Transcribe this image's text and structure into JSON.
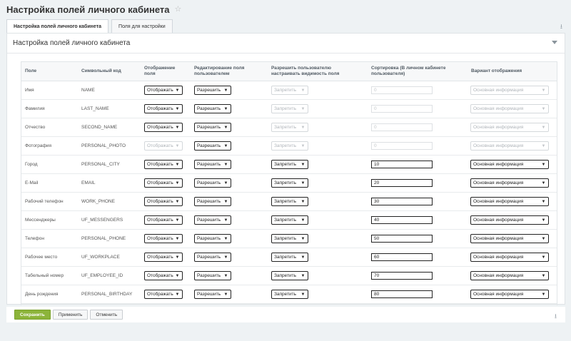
{
  "page": {
    "title": "Настройка полей личного кабинета"
  },
  "tabs": [
    {
      "label": "Настройка полей личного кабинета",
      "active": true
    },
    {
      "label": "Поля для настройки",
      "active": false
    }
  ],
  "panel": {
    "title": "Настройка полей личного кабинета"
  },
  "table": {
    "headers": {
      "field": "Поле",
      "code": "Символьный код",
      "display": [
        "Отображение",
        "поля"
      ],
      "edit": [
        "Редактирование поля",
        "пользователем"
      ],
      "visibility": [
        "Разрешить пользователю",
        "настраивать видимость поля"
      ],
      "sort": [
        "Сортировка (В личном кабинете",
        "пользователя)"
      ],
      "variant": "Вариант отображения"
    },
    "rows": [
      {
        "field": "Имя",
        "code": "NAME",
        "display": "Отображать",
        "edit": "Разрешить",
        "visibility": "Запретить",
        "sort": "0",
        "variant": "Основная информация",
        "display_disabled": false,
        "edit_disabled": false,
        "rest_disabled": true
      },
      {
        "field": "Фамилия",
        "code": "LAST_NAME",
        "display": "Отображать",
        "edit": "Разрешить",
        "visibility": "Запретить",
        "sort": "0",
        "variant": "Основная информация",
        "display_disabled": false,
        "edit_disabled": false,
        "rest_disabled": true
      },
      {
        "field": "Отчество",
        "code": "SECOND_NAME",
        "display": "Отображать",
        "edit": "Разрешить",
        "visibility": "Запретить",
        "sort": "0",
        "variant": "Основная информация",
        "display_disabled": false,
        "edit_disabled": false,
        "rest_disabled": true
      },
      {
        "field": "Фотография",
        "code": "PERSONAL_PHOTO",
        "display": "Отображать",
        "edit": "Разрешить",
        "visibility": "Запретить",
        "sort": "0",
        "variant": "Основная информация",
        "display_disabled": true,
        "edit_disabled": false,
        "rest_disabled": true
      },
      {
        "field": "Город",
        "code": "PERSONAL_CITY",
        "display": "Отображать",
        "edit": "Разрешить",
        "visibility": "Запретить",
        "sort": "10",
        "variant": "Основная информация",
        "display_disabled": false,
        "edit_disabled": false,
        "rest_disabled": false
      },
      {
        "field": "E-Mail",
        "code": "EMAIL",
        "display": "Отображать",
        "edit": "Разрешить",
        "visibility": "Запретить",
        "sort": "20",
        "variant": "Основная информация",
        "display_disabled": false,
        "edit_disabled": false,
        "rest_disabled": false
      },
      {
        "field": "Рабочий телефон",
        "code": "WORK_PHONE",
        "display": "Отображать",
        "edit": "Разрешить",
        "visibility": "Запретить",
        "sort": "30",
        "variant": "Основная информация",
        "display_disabled": false,
        "edit_disabled": false,
        "rest_disabled": false
      },
      {
        "field": "Мессенджеры",
        "code": "UF_MESSENGERS",
        "display": "Отображать",
        "edit": "Разрешить",
        "visibility": "Запретить",
        "sort": "40",
        "variant": "Основная информация",
        "display_disabled": false,
        "edit_disabled": false,
        "rest_disabled": false
      },
      {
        "field": "Телефон",
        "code": "PERSONAL_PHONE",
        "display": "Отображать",
        "edit": "Разрешить",
        "visibility": "Запретить",
        "sort": "50",
        "variant": "Основная информация",
        "display_disabled": false,
        "edit_disabled": false,
        "rest_disabled": false
      },
      {
        "field": "Рабочее место",
        "code": "UF_WORKPLACE",
        "display": "Отображать",
        "edit": "Разрешить",
        "visibility": "Запретить",
        "sort": "60",
        "variant": "Основная информация",
        "display_disabled": false,
        "edit_disabled": false,
        "rest_disabled": false
      },
      {
        "field": "Табельный номер",
        "code": "UF_EMPLOYEE_ID",
        "display": "Отображать",
        "edit": "Разрешить",
        "visibility": "Запретить",
        "sort": "70",
        "variant": "Основная информация",
        "display_disabled": false,
        "edit_disabled": false,
        "rest_disabled": false
      },
      {
        "field": "День рождения",
        "code": "PERSONAL_BIRTHDAY",
        "display": "Отображать",
        "edit": "Разрешить",
        "visibility": "Запретить",
        "sort": "80",
        "variant": "Основная информация",
        "display_disabled": false,
        "edit_disabled": false,
        "rest_disabled": false
      }
    ]
  },
  "footer": {
    "save_label": "Сохранить",
    "apply_label": "Применить",
    "cancel_label": "Отменить"
  },
  "colors": {
    "primary_button": "#8cb43a",
    "background": "#eef2f4",
    "panel": "#ffffff"
  },
  "icons": {
    "favorite": "star-icon",
    "pin": "pin-icon",
    "collapse": "chevron-down-icon",
    "select": "chevron-down-icon"
  }
}
